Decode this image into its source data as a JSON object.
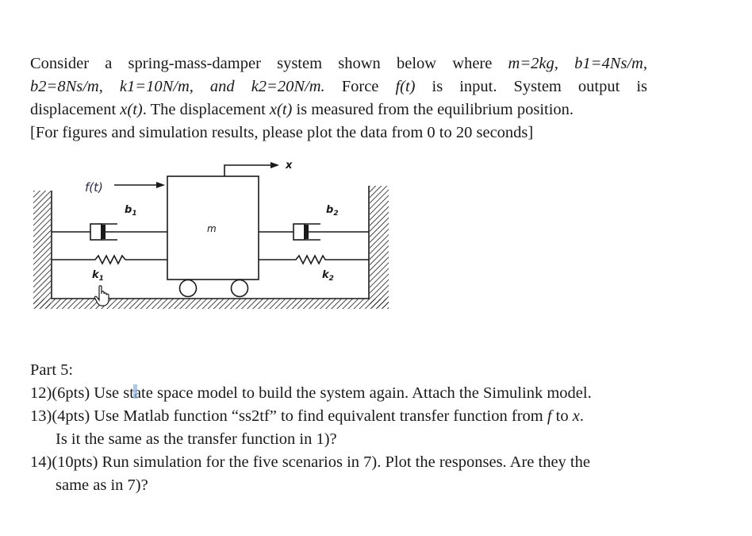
{
  "problem": {
    "intro_lines": [
      [
        "Consider a spring-mass-damper system shown below where ",
        "m=2kg,",
        " ",
        "b1=4Ns/m,"
      ],
      [
        "b2=8Ns/m,",
        " ",
        "k1=10N/m,",
        " ",
        "and",
        " ",
        "k2=20N/m.",
        " Force ",
        "f(t)",
        " is input. System output is"
      ],
      [
        "displacement ",
        "x(t)",
        ". The displacement ",
        "x(t)",
        " is measured from the equilibrium position."
      ],
      [
        "[For figures and simulation results, please plot the data from 0 to 20 seconds]"
      ]
    ],
    "parameters": {
      "m": "2kg",
      "b1": "4Ns/m",
      "b2": "8Ns/m",
      "k1": "10N/m",
      "k2": "20N/m"
    }
  },
  "diagram": {
    "labels": {
      "force": "f(t)",
      "displacement": "x",
      "mass": "m",
      "damper_left": "b",
      "damper_left_sub": "1",
      "damper_right": "b",
      "damper_right_sub": "2",
      "spring_left": "k",
      "spring_left_sub": "1",
      "spring_right": "k",
      "spring_right_sub": "2"
    },
    "colors": {
      "line": "#1a1a1a",
      "force_label": "#2a2a44"
    }
  },
  "part5": {
    "heading": "Part 5:",
    "items": [
      {
        "num": "12)",
        "text": "(6pts) Use state space model to build the system again. Attach the Simulink model."
      },
      {
        "num": "13)",
        "text_a": "(4pts) Use Matlab function “ss2tf” to find equivalent transfer function from ",
        "var_f": "f",
        "text_b": " to ",
        "var_x": "x",
        "text_c": ".",
        "cont": "Is it the same as the transfer function in 1)?"
      },
      {
        "num": "14)",
        "text": "(10pts) Run simulation for the five scenarios in 7). Plot the responses. Are they the",
        "cont": "same as in 7)?"
      }
    ]
  }
}
